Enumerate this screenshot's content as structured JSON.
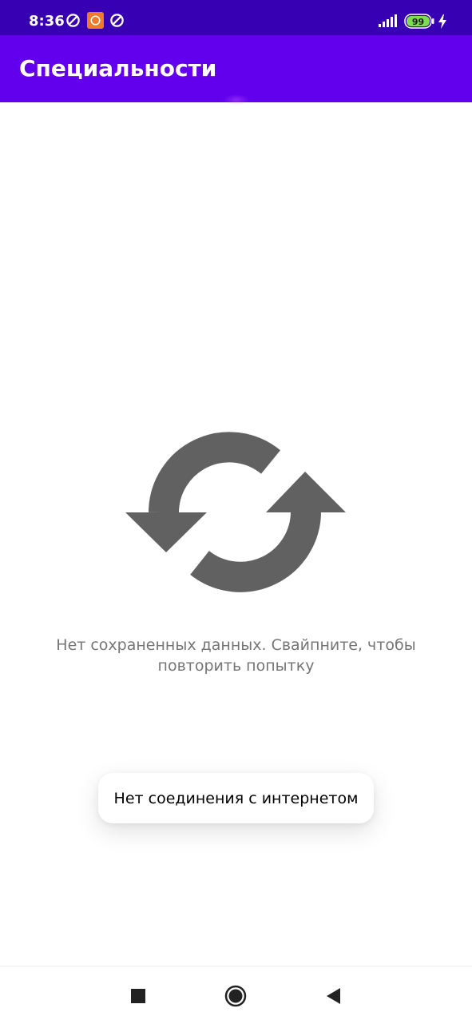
{
  "status_bar": {
    "time": "8:36",
    "battery_level": "99",
    "icons": [
      "sync-icon",
      "app-notification-icon",
      "sync-icon",
      "signal-icon",
      "battery-icon",
      "charging-icon"
    ]
  },
  "app_bar": {
    "title": "Специальности",
    "color": "#6200ee"
  },
  "empty_state": {
    "icon": "refresh-icon",
    "message": "Нет сохраненных данных. Свайпните, чтобы повторить попытку"
  },
  "toast": {
    "text": "Нет соединения с интернетом"
  },
  "nav_bar": {
    "buttons": [
      "recents-button",
      "home-button",
      "back-button"
    ]
  },
  "colors": {
    "status_bar": "#3700b3",
    "app_bar": "#6200ee",
    "icon_gray": "#616161",
    "message_gray": "#757575"
  }
}
